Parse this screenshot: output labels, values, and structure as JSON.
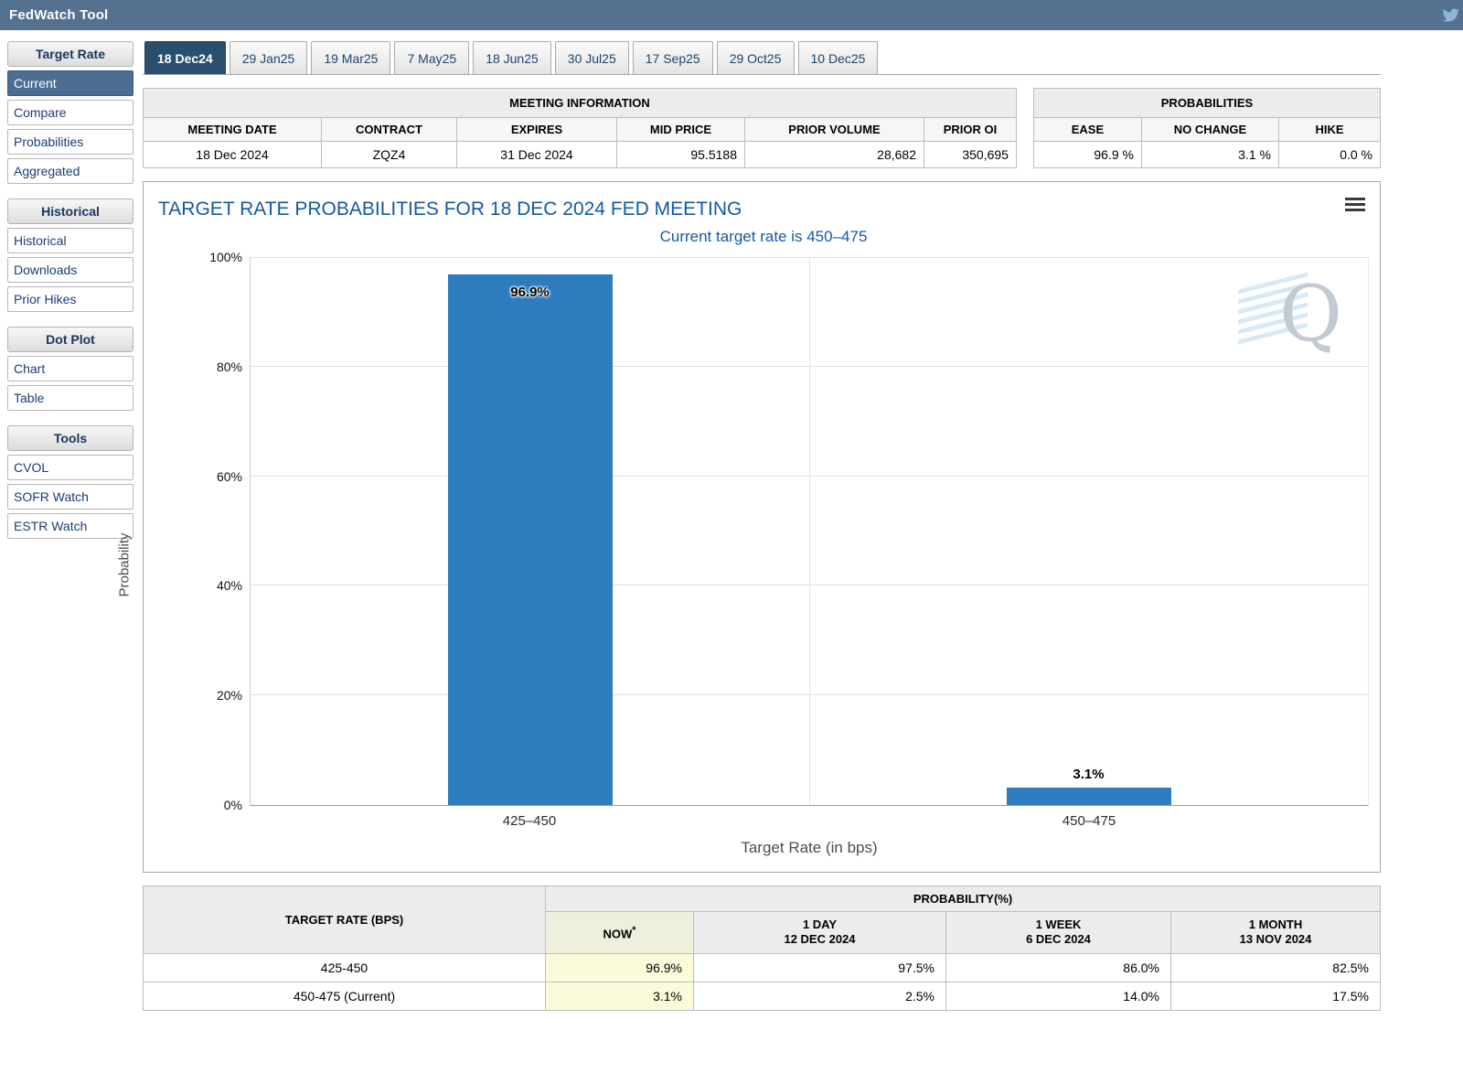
{
  "header": {
    "title": "FedWatch Tool"
  },
  "sidebar": {
    "sections": [
      {
        "title": "Target Rate",
        "items": [
          {
            "label": "Current"
          },
          {
            "label": "Compare"
          },
          {
            "label": "Probabilities"
          },
          {
            "label": "Aggregated"
          }
        ]
      },
      {
        "title": "Historical",
        "items": [
          {
            "label": "Historical"
          },
          {
            "label": "Downloads"
          },
          {
            "label": "Prior Hikes"
          }
        ]
      },
      {
        "title": "Dot Plot",
        "items": [
          {
            "label": "Chart"
          },
          {
            "label": "Table"
          }
        ]
      },
      {
        "title": "Tools",
        "items": [
          {
            "label": "CVOL"
          },
          {
            "label": "SOFR Watch"
          },
          {
            "label": "ESTR Watch"
          }
        ]
      }
    ]
  },
  "tabs": [
    "18 Dec24",
    "29 Jan25",
    "19 Mar25",
    "7 May25",
    "18 Jun25",
    "30 Jul25",
    "17 Sep25",
    "29 Oct25",
    "10 Dec25"
  ],
  "active_tab": "18 Dec24",
  "meeting_info": {
    "title": "MEETING INFORMATION",
    "columns": [
      "MEETING DATE",
      "CONTRACT",
      "EXPIRES",
      "MID PRICE",
      "PRIOR VOLUME",
      "PRIOR OI"
    ],
    "values": [
      "18 Dec 2024",
      "ZQZ4",
      "31 Dec 2024",
      "95.5188",
      "28,682",
      "350,695"
    ]
  },
  "probabilities": {
    "title": "PROBABILITIES",
    "columns": [
      "EASE",
      "NO CHANGE",
      "HIKE"
    ],
    "values": [
      "96.9 %",
      "3.1 %",
      "0.0 %"
    ]
  },
  "chart_data": {
    "type": "bar",
    "title": "TARGET RATE PROBABILITIES FOR 18 DEC 2024 FED MEETING",
    "subtitle": "Current target rate is 450–475",
    "categories": [
      "425–450",
      "450–475"
    ],
    "values": [
      96.9,
      3.1
    ],
    "labels": [
      "96.9%",
      "3.1%"
    ],
    "xlabel": "Target Rate (in bps)",
    "ylabel": "Probability",
    "ylim": [
      0,
      100
    ],
    "yticks": [
      "100%",
      "80%",
      "60%",
      "40%",
      "20%",
      "0%"
    ],
    "bar_color": "#2d7cbd",
    "grid": true,
    "legend": "none"
  },
  "bottom_table": {
    "rate_header": "TARGET RATE (BPS)",
    "group_header": "PROBABILITY(%)",
    "now_header": {
      "label": "NOW",
      "sup": "*"
    },
    "period_headers": [
      {
        "line1": "1 DAY",
        "line2": "12 DEC 2024"
      },
      {
        "line1": "1 WEEK",
        "line2": "6 DEC 2024"
      },
      {
        "line1": "1 MONTH",
        "line2": "13 NOV 2024"
      }
    ],
    "rows": [
      {
        "rate": "425-450",
        "values": [
          "96.9%",
          "97.5%",
          "86.0%",
          "82.5%"
        ]
      },
      {
        "rate": "450-475 (Current)",
        "values": [
          "3.1%",
          "2.5%",
          "14.0%",
          "17.5%"
        ]
      }
    ]
  }
}
